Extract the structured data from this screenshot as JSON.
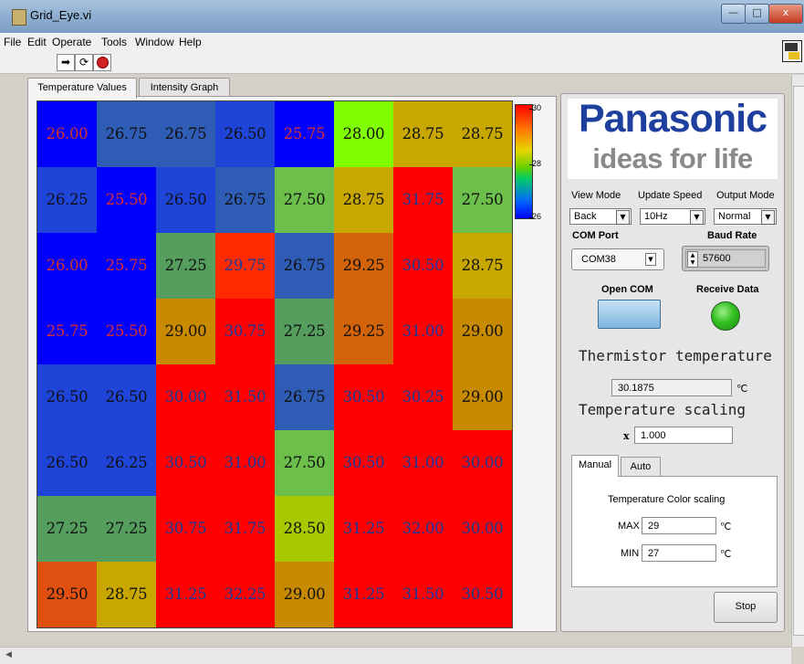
{
  "window": {
    "title": "Grid_Eye.vi",
    "min_glyph": "—",
    "max_glyph": "□",
    "close_glyph": "x"
  },
  "menu": [
    "File",
    "Edit",
    "Operate",
    "Tools",
    "Window",
    "Help"
  ],
  "toolbar": {
    "run_glyph": "➡",
    "run_continuous_glyph": "⟳"
  },
  "tabs": [
    "Temperature Values",
    "Intensity Graph"
  ],
  "grid": {
    "rows": [
      [
        "26.00",
        "26.75",
        "26.75",
        "26.50",
        "25.75",
        "28.00",
        "28.75",
        "28.75"
      ],
      [
        "26.25",
        "25.50",
        "26.50",
        "26.75",
        "27.50",
        "28.75",
        "31.75",
        "27.50"
      ],
      [
        "26.00",
        "25.75",
        "27.25",
        "29.75",
        "26.75",
        "29.25",
        "30.50",
        "28.75"
      ],
      [
        "25.75",
        "25.50",
        "29.00",
        "30.75",
        "27.25",
        "29.25",
        "31.00",
        "29.00"
      ],
      [
        "26.50",
        "26.50",
        "30.00",
        "31.50",
        "26.75",
        "30.50",
        "30.25",
        "29.00"
      ],
      [
        "26.50",
        "26.25",
        "30.50",
        "31.00",
        "27.50",
        "30.50",
        "31.00",
        "30.00"
      ],
      [
        "27.25",
        "27.25",
        "30.75",
        "31.75",
        "28.50",
        "31.25",
        "32.00",
        "30.00"
      ],
      [
        "29.50",
        "28.75",
        "31.25",
        "32.25",
        "29.00",
        "31.25",
        "31.50",
        "30.50"
      ]
    ],
    "colors": [
      [
        "#0000ff",
        "#2f5cb4",
        "#2f5cb4",
        "#1e44d8",
        "#0000ff",
        "#80ff00",
        "#c8a800",
        "#c8a800"
      ],
      [
        "#1e44d8",
        "#0000ff",
        "#1e44d8",
        "#2f5cb4",
        "#6bbf4a",
        "#c8a800",
        "#ff0000",
        "#6bbf4a"
      ],
      [
        "#0000ff",
        "#0000ff",
        "#559e5e",
        "#ff2a00",
        "#2f5cb4",
        "#d4640a",
        "#ff0000",
        "#c8a800"
      ],
      [
        "#0000ff",
        "#0000ff",
        "#c88a00",
        "#ff0000",
        "#559e5e",
        "#d4640a",
        "#ff0000",
        "#c88a00"
      ],
      [
        "#1e44d8",
        "#1e44d8",
        "#ff0000",
        "#ff0000",
        "#2f5cb4",
        "#ff0000",
        "#ff0000",
        "#c88a00"
      ],
      [
        "#1e44d8",
        "#1e44d8",
        "#ff0000",
        "#ff0000",
        "#6bbf4a",
        "#ff0000",
        "#ff0000",
        "#ff0000"
      ],
      [
        "#559e5e",
        "#559e5e",
        "#ff0000",
        "#ff0000",
        "#a8c800",
        "#ff0000",
        "#ff0000",
        "#ff0000"
      ],
      [
        "#e05010",
        "#c8a800",
        "#ff0000",
        "#ff0000",
        "#c88a00",
        "#ff0000",
        "#ff0000",
        "#ff0000"
      ]
    ],
    "red_text_color": "#d43030",
    "blue_text_color": "#1a3a9a"
  },
  "color_scale": {
    "ticks": [
      "30",
      "28",
      "26"
    ]
  },
  "logo": {
    "brand": "Panasonic",
    "tagline": "ideas for life"
  },
  "controls": {
    "view_mode_label": "View Mode",
    "view_mode_value": "Back",
    "update_speed_label": "Update Speed",
    "update_speed_value": "10Hz",
    "output_mode_label": "Output Mode",
    "output_mode_value": "Normal",
    "com_port_label": "COM Port",
    "com_port_value": "COM38",
    "baud_rate_label": "Baud Rate",
    "baud_rate_value": "57600",
    "open_com_label": "Open COM",
    "receive_data_label": "Receive Data",
    "thermistor_label": "Thermistor temperature",
    "thermistor_value": "30.1875",
    "thermistor_unit": "℃",
    "scaling_label": "Temperature scaling",
    "scaling_prefix": "x",
    "scaling_value": "1.000"
  },
  "subtabs": [
    "Manual",
    "Auto"
  ],
  "color_scaling": {
    "title": "Temperature Color scaling",
    "max_label": "MAX",
    "max_value": "29",
    "min_label": "MIN",
    "min_value": "27",
    "unit": "℃"
  },
  "stop_label": "Stop"
}
